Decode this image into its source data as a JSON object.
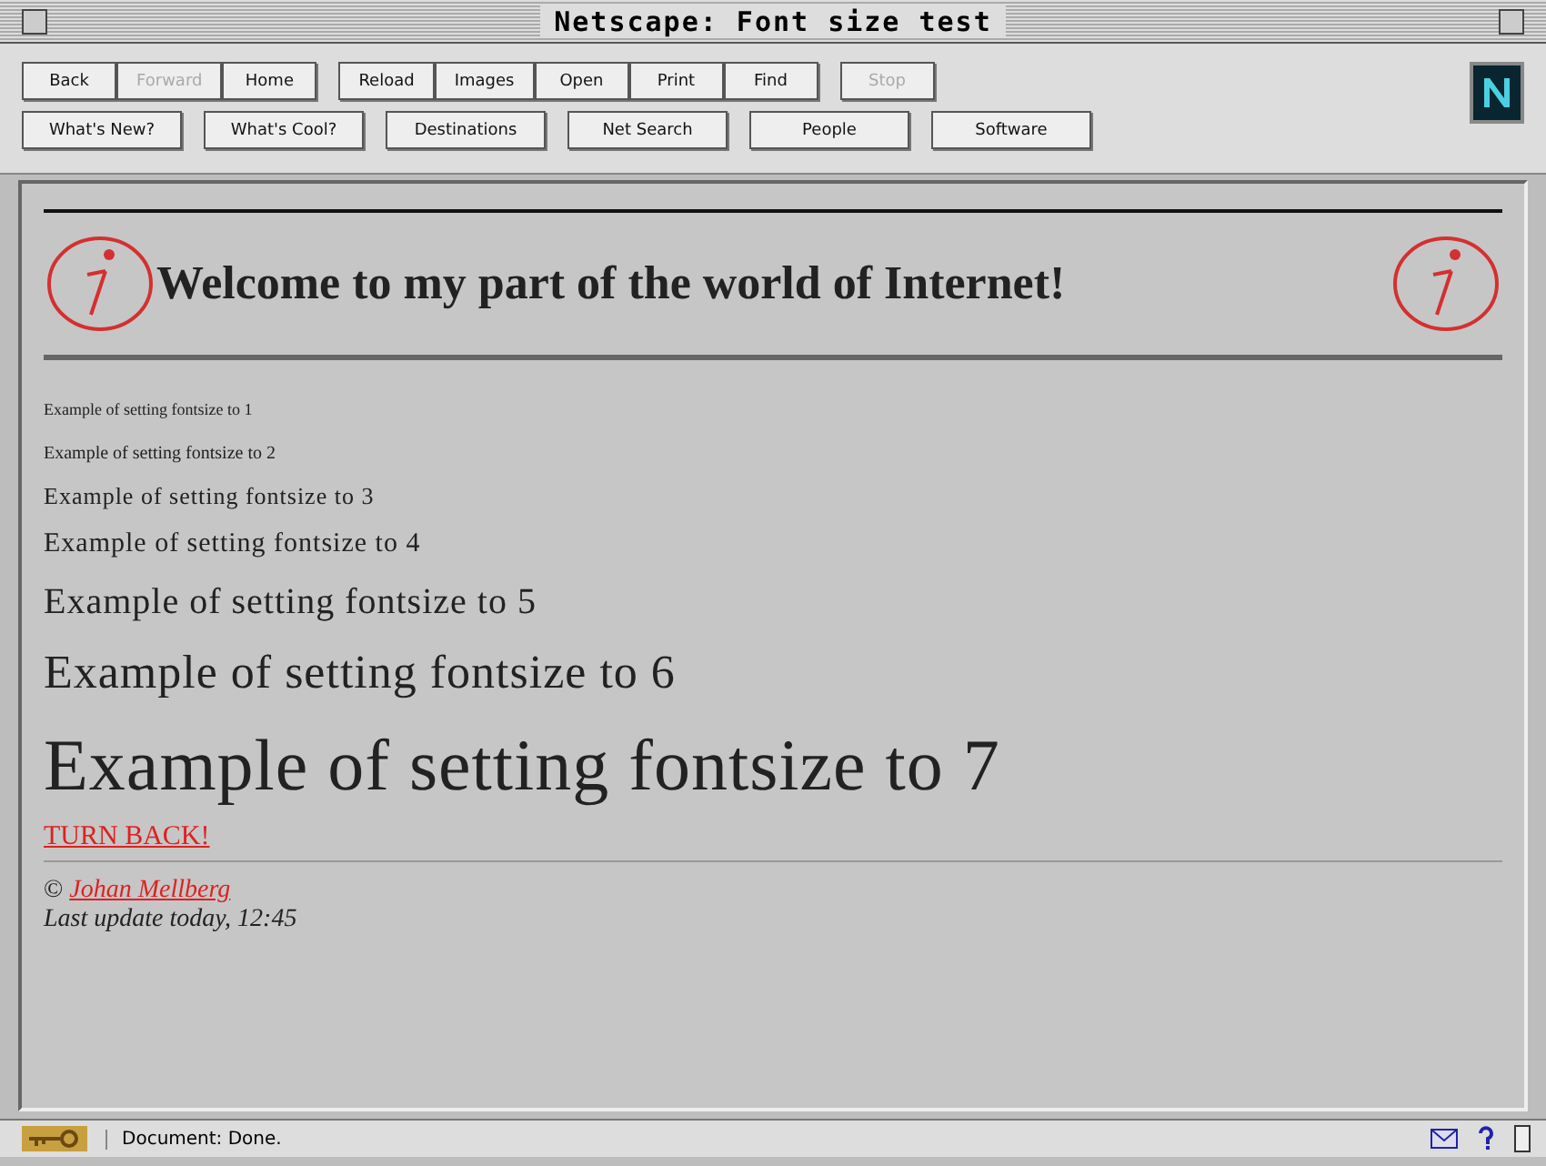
{
  "window": {
    "title": "Netscape: Font size test"
  },
  "toolbar": {
    "groups": [
      [
        {
          "label": "Back",
          "disabled": false
        },
        {
          "label": "Forward",
          "disabled": true
        },
        {
          "label": "Home",
          "disabled": false
        }
      ],
      [
        {
          "label": "Reload",
          "disabled": false
        },
        {
          "label": "Images",
          "disabled": false
        },
        {
          "label": "Open",
          "disabled": false
        },
        {
          "label": "Print",
          "disabled": false
        },
        {
          "label": "Find",
          "disabled": false
        }
      ],
      [
        {
          "label": "Stop",
          "disabled": true
        }
      ]
    ]
  },
  "directory_buttons": [
    {
      "label": "What's New?"
    },
    {
      "label": "What's Cool?"
    },
    {
      "label": "Destinations"
    },
    {
      "label": "Net Search"
    },
    {
      "label": "People"
    },
    {
      "label": "Software"
    }
  ],
  "page": {
    "heading": "Welcome to my part of the world of Internet!",
    "examples": [
      "Example of setting fontsize to 1",
      "Example of setting fontsize to 2",
      "Example of setting fontsize to 3",
      "Example of setting fontsize to 4",
      "Example of setting fontsize to 5",
      "Example of setting fontsize to 6",
      "Example of setting fontsize to 7"
    ],
    "back_link": "TURN BACK!",
    "copyright": "©",
    "author_link": "Johan Mellberg",
    "updated": "Last update today, 12:45"
  },
  "status_bar": {
    "text": "Document: Done."
  }
}
